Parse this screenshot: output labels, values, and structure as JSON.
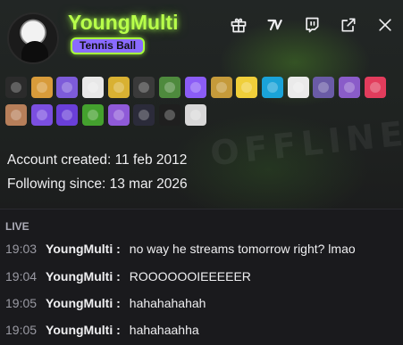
{
  "header": {
    "display_name": "YoungMulti",
    "badge_label": "Tennis Ball",
    "banner_watermark": "OFFLINE"
  },
  "toolbar": {
    "buttons": [
      "gift-icon",
      "7tv-icon",
      "twitch-icon",
      "open-external-icon",
      "close-icon"
    ]
  },
  "badges": {
    "row1": [
      {
        "name": "sparkle-7tv-badge-icon",
        "color": "#2b2b2b"
      },
      {
        "name": "crown-cat-emote-icon",
        "color": "#d89b3a"
      },
      {
        "name": "purple-tulip-emote-icon",
        "color": "#7d5bd9"
      },
      {
        "name": "panda-emote-icon",
        "color": "#e8e8e8"
      },
      {
        "name": "banana-emote-icon",
        "color": "#d9b132"
      },
      {
        "name": "hollow-knight-emote-icon",
        "color": "#3a3a3a"
      },
      {
        "name": "pickaxe-emote-icon",
        "color": "#4e8a3d"
      },
      {
        "name": "verified-purple-icon",
        "color": "#8b5cf6"
      },
      {
        "name": "cross-medal-emote-icon",
        "color": "#c59a3a"
      },
      {
        "name": "pikachu-emote-icon",
        "color": "#f0cf3a"
      },
      {
        "name": "blue-crown-badge-icon",
        "color": "#1aa3d8"
      },
      {
        "name": "white-block-emote-icon",
        "color": "#eaeaea"
      },
      {
        "name": "winged-creature-emote-icon",
        "color": "#6a5ba6"
      },
      {
        "name": "cake-emote-icon",
        "color": "#8a5cc9"
      },
      {
        "name": "pink-heart-badge-icon",
        "color": "#e23c5c"
      }
    ],
    "row2": [
      {
        "name": "bronze-crest-emote-icon",
        "color": "#b77f5a"
      },
      {
        "name": "purple-b-badge-icon",
        "color": "#7b4fe0"
      },
      {
        "name": "purple-wave-badge-icon",
        "color": "#6a3fd8"
      },
      {
        "name": "green-grass-emote-icon",
        "color": "#44a12e"
      },
      {
        "name": "year-2023-badge-icon",
        "color": "#8f5ad8"
      },
      {
        "name": "year-2024-badge-icon",
        "color": "#2b2b3a"
      },
      {
        "name": "year-2025-badge-icon",
        "color": "#1f1f1f"
      },
      {
        "name": "umbrella-emblem-icon",
        "color": "#d8d8d8"
      }
    ]
  },
  "info": {
    "account_created": "Account created: 11 feb 2012",
    "following_since": "Following since: 13 mar 2026"
  },
  "chat": {
    "section_label": "LIVE",
    "messages": [
      {
        "time": "19:03",
        "user": "YoungMulti",
        "text": "no way he streams tomorrow right? lmao"
      },
      {
        "time": "19:04",
        "user": "YoungMulti",
        "text": "ROOOOOOIEEEEER"
      },
      {
        "time": "19:05",
        "user": "YoungMulti",
        "text": "hahahahahah"
      },
      {
        "time": "19:05",
        "user": "YoungMulti",
        "text": "hahahaahha"
      }
    ]
  }
}
